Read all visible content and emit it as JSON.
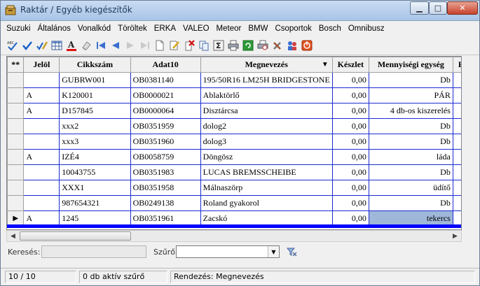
{
  "window": {
    "title": "Raktár / Egyéb kiegészítők",
    "controls": {
      "minimize": "▁",
      "maximize": "□",
      "close": "✕"
    }
  },
  "menu": [
    "Suzuki",
    "Általános",
    "Vonalkód",
    "Töröltek",
    "ERKA",
    "VALEO",
    "Meteor",
    "BMW",
    "Csoportok",
    "Bosch",
    "Omnibusz"
  ],
  "toolbar_icons": [
    "spellcheck-icon",
    "check-icon",
    "edit-check-icon",
    "table-icon",
    "text-color-icon",
    "eraser-icon",
    "first-record-icon",
    "prev-record-icon",
    "next-record-icon",
    "last-record-icon",
    "new-record-icon",
    "edit-record-icon",
    "delete-record-icon",
    "copy-icon",
    "sum-icon",
    "print-icon",
    "refresh-icon",
    "print-preview-icon",
    "tools-icon",
    "users-icon",
    "exit-icon"
  ],
  "grid": {
    "columns": [
      {
        "label": "**"
      },
      {
        "label": "Jelöl"
      },
      {
        "label": "Cikkszám"
      },
      {
        "label": "Adat10"
      },
      {
        "label": "Megnevezés",
        "sort_indicator": "▼"
      },
      {
        "label": "Készlet"
      },
      {
        "label": "Mennyiségi egység"
      },
      {
        "label": "E"
      }
    ],
    "rows": [
      {
        "indicator": "",
        "mark": "",
        "code": "GUBRW001",
        "data10": "OB0381140",
        "name": "195/50R16 LM25H BRIDGESTONE",
        "stock": "0,00",
        "unit": "Db"
      },
      {
        "indicator": "",
        "mark": "A",
        "code": "K120001",
        "data10": "OB0000021",
        "name": "Ablaktörlő",
        "stock": "0,00",
        "unit": "PÁR"
      },
      {
        "indicator": "",
        "mark": "A",
        "code": "D157845",
        "data10": "OB0000064",
        "name": "Disztárcsa",
        "stock": "0,00",
        "unit": "4 db-os kiszerelés"
      },
      {
        "indicator": "",
        "mark": "",
        "code": "xxx2",
        "data10": "OB0351959",
        "name": "dolog2",
        "stock": "0,00",
        "unit": "Db"
      },
      {
        "indicator": "",
        "mark": "",
        "code": "xxx3",
        "data10": "OB0351960",
        "name": "dolog3",
        "stock": "0,00",
        "unit": "Db"
      },
      {
        "indicator": "",
        "mark": "A",
        "code": "IZÉ4",
        "data10": "OB0058759",
        "name": "Döngösz",
        "stock": "0,00",
        "unit": "láda"
      },
      {
        "indicator": "",
        "mark": "",
        "code": "10043755",
        "data10": "OB0351983",
        "name": "LUCAS BREMSSCHEIBE",
        "stock": "0,00",
        "unit": "Db"
      },
      {
        "indicator": "",
        "mark": "",
        "code": "XXX1",
        "data10": "OB0351958",
        "name": "Málnaszörp",
        "stock": "0,00",
        "unit": "üdítő"
      },
      {
        "indicator": "",
        "mark": "",
        "code": "987654321",
        "data10": "OB0249138",
        "name": "Roland gyakorol",
        "stock": "0,00",
        "unit": "Db"
      },
      {
        "indicator": "▶",
        "mark": "A",
        "code": "1245",
        "data10": "OB0351961",
        "name": "Zacskó",
        "stock": "0,00",
        "unit": "tekercs"
      }
    ]
  },
  "filter": {
    "search_label": "Keresés:",
    "search_value": "",
    "filter_label": "Szűrő:",
    "filter_value": ""
  },
  "status": {
    "record": "10 / 10",
    "active_filters": "0 db aktív szűrő",
    "sort": "Rendezés: Megnevezés"
  },
  "colors": {
    "grid_border": "#1c2bd0",
    "selected_cell": "#9fb7d9",
    "new_row_line": "#0000ff"
  }
}
